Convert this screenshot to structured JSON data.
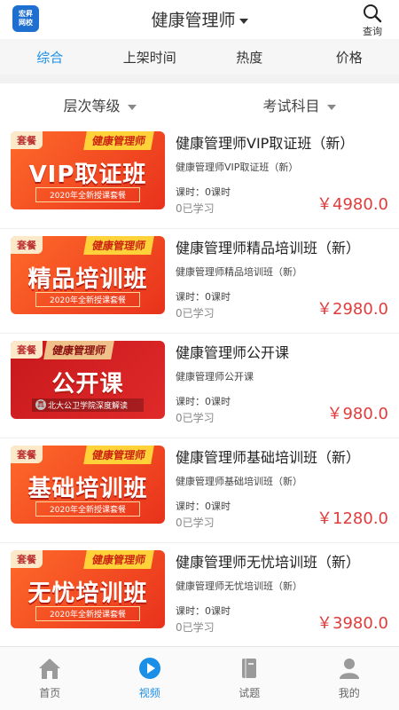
{
  "header": {
    "logo_line1": "宏昇",
    "logo_line2": "网校",
    "title": "健康管理师",
    "search_label": "查询"
  },
  "sort_tabs": [
    "综合",
    "上架时间",
    "热度",
    "价格"
  ],
  "filters": [
    "层次等级",
    "考试科目"
  ],
  "courses": [
    {
      "tag": "套餐",
      "ribbon": "健康管理师",
      "thumb_title": "VIP取证班",
      "thumb_bar": "2020年全新授课套餐",
      "name": "健康管理师VIP取证班（新）",
      "sub": "健康管理师VIP取证班（新）",
      "hours": "课时：0课时",
      "learners": "0已学习",
      "price": "￥4980.0"
    },
    {
      "tag": "套餐",
      "ribbon": "健康管理师",
      "thumb_title": "精品培训班",
      "thumb_bar": "2020年全新授课套餐",
      "name": "健康管理师精品培训班（新）",
      "sub": "健康管理师精品培训班（新）",
      "hours": "课时：0课时",
      "learners": "0已学习",
      "price": "￥2980.0"
    },
    {
      "tag": "套餐",
      "ribbon": "健康管理师",
      "thumb_title": "公开课",
      "thumb_bar": "北大公卫学院深度解读",
      "name": "健康管理师公开课",
      "sub": "健康管理师公开课",
      "hours": "课时：0课时",
      "learners": "0已学习",
      "price": "￥980.0"
    },
    {
      "tag": "套餐",
      "ribbon": "健康管理师",
      "thumb_title": "基础培训班",
      "thumb_bar": "2020年全新授课套餐",
      "name": "健康管理师基础培训班（新）",
      "sub": "健康管理师基础培训班（新）",
      "hours": "课时：0课时",
      "learners": "0已学习",
      "price": "￥1280.0"
    },
    {
      "tag": "套餐",
      "ribbon": "健康管理师",
      "thumb_title": "无忧培训班",
      "thumb_bar": "2020年全新授课套餐",
      "name": "健康管理师无忧培训班（新）",
      "sub": "健康管理师无忧培训班（新）",
      "hours": "课时：0课时",
      "learners": "0已学习",
      "price": "￥3980.0"
    }
  ],
  "thumb3_badge": "真",
  "tabbar": [
    {
      "label": "首页",
      "icon": "home-icon"
    },
    {
      "label": "视频",
      "icon": "play-icon"
    },
    {
      "label": "试题",
      "icon": "book-icon"
    },
    {
      "label": "我的",
      "icon": "user-icon"
    }
  ],
  "colors": {
    "accent": "#1a8fe8",
    "price": "#e03c3c"
  }
}
